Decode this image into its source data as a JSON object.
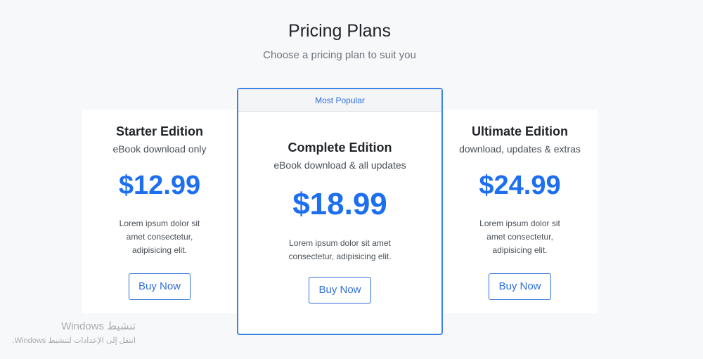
{
  "header": {
    "title": "Pricing Plans",
    "subtitle": "Choose a pricing plan to suit you"
  },
  "plans": [
    {
      "name": "Starter Edition",
      "subtitle": "eBook download only",
      "price": "$12.99",
      "description": "Lorem ipsum dolor sit amet consectetur, adipisicing elit.",
      "button_label": "Buy Now"
    },
    {
      "badge": "Most Popular",
      "name": "Complete Edition",
      "subtitle": "eBook download & all updates",
      "price": "$18.99",
      "description": "Lorem ipsum dolor sit amet consectetur, adipisicing elit.",
      "button_label": "Buy Now"
    },
    {
      "name": "Ultimate Edition",
      "subtitle": "download, updates & extras",
      "price": "$24.99",
      "description": "Lorem ipsum dolor sit amet consectetur, adipisicing elit.",
      "button_label": "Buy Now"
    }
  ],
  "watermark": {
    "line1": "تنشيط Windows",
    "line2": "انتقل إلى الإعدادات لتنشيط Windows."
  },
  "colors": {
    "accent": "#1d6ff0",
    "featured_border": "#3b82e6",
    "background": "#f7f8fa"
  }
}
